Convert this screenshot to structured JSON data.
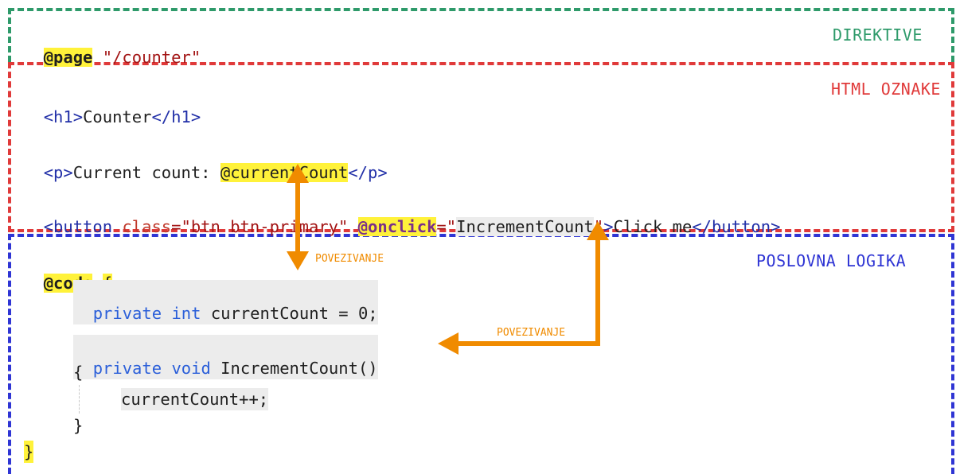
{
  "regions": {
    "directives": {
      "label": "DIREKTIVE",
      "color": "#2e9a6a"
    },
    "html_markup": {
      "label": "HTML OZNAKE",
      "color": "#e03a3a"
    },
    "business_logic": {
      "label": "POSLOVNA LOGIKA",
      "color": "#2f35d4"
    }
  },
  "code": {
    "page_directive": "@page",
    "page_route": "\"/counter\"",
    "h1_open": "<h1>",
    "h1_text": "Counter",
    "h1_close": "</h1>",
    "p_open": "<p>",
    "p_text": "Current count: ",
    "p_binding": "@currentCount",
    "p_close": "</p>",
    "button_open": "<button",
    "button_attr_class": "class",
    "button_class_value": "=\"btn btn-primary\"",
    "button_onclick": "@onclick",
    "button_eq": "=\"",
    "button_handler": "IncrementCount",
    "button_quote_close": "\"",
    "button_gt": ">",
    "button_text": "Click me",
    "button_close": "</button>",
    "code_directive": "@code",
    "brace_open": "{",
    "field_private": "private",
    "field_int": "int",
    "field_rest": "currentCount = 0;",
    "method_private": "private",
    "method_void": "void",
    "method_name": "IncrementCount()",
    "method_brace_open": "{",
    "method_body": "currentCount++;",
    "method_brace_close": "}",
    "brace_close": "}"
  },
  "annotations": {
    "binding_label_1": "POVEZIVANJE",
    "binding_label_2": "POVEZIVANJE",
    "arrow_color": "#f08b00"
  }
}
